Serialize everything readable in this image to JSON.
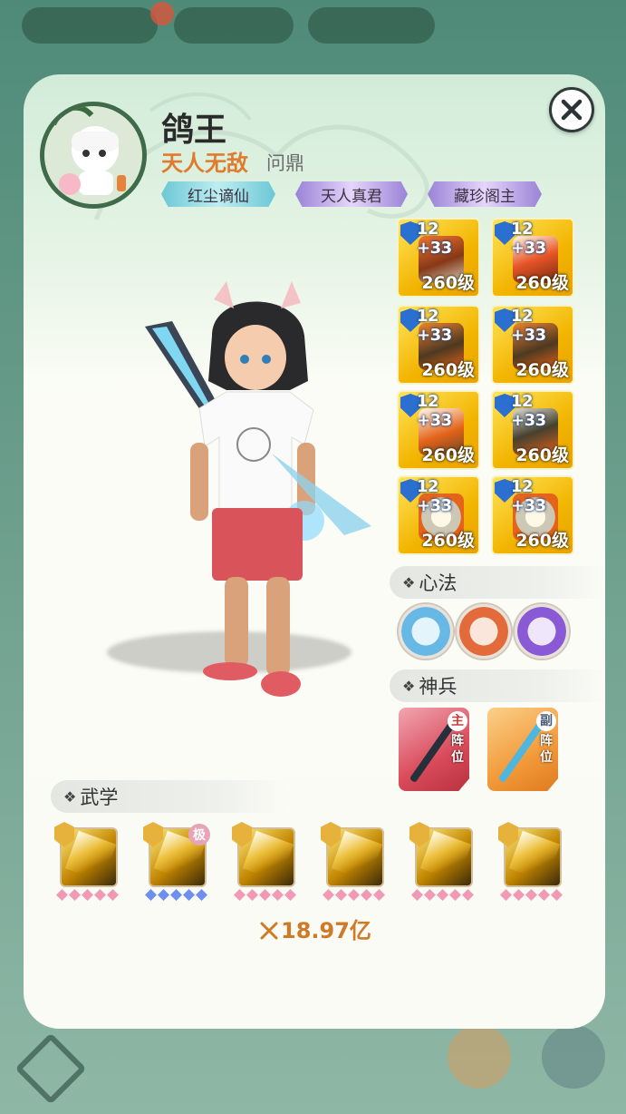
{
  "player": {
    "name": "鸽王",
    "title": "天人无敌",
    "guild": "问鼎"
  },
  "badges": [
    "红尘谪仙",
    "天人真君",
    "藏珍阁主"
  ],
  "equipment": [
    {
      "tier": "12",
      "enhance": "+33",
      "level": "260级"
    },
    {
      "tier": "12",
      "enhance": "+33",
      "level": "260级"
    },
    {
      "tier": "12",
      "enhance": "+33",
      "level": "260级"
    },
    {
      "tier": "12",
      "enhance": "+33",
      "level": "260级"
    },
    {
      "tier": "12",
      "enhance": "+33",
      "level": "260级"
    },
    {
      "tier": "12",
      "enhance": "+33",
      "level": "260级"
    },
    {
      "tier": "12",
      "enhance": "+33",
      "level": "260级"
    },
    {
      "tier": "12",
      "enhance": "+33",
      "level": "260级"
    }
  ],
  "sections": {
    "xinfa": "心法",
    "shenbing": "神兵",
    "wuxue": "武学"
  },
  "shenbing": {
    "primary": {
      "tag": "主",
      "pos": "阵位"
    },
    "secondary": {
      "tag": "副",
      "pos": "阵位"
    }
  },
  "skill_max_label": "极",
  "power": "18.97亿",
  "colors": {
    "title_orange": "#e07a2c",
    "power_orange": "#d07a27",
    "card_top": "#d2ecd9",
    "equip_gold": "#f2b400",
    "weapon_red": "#d94a5a",
    "weapon_orange": "#f29a3a"
  }
}
